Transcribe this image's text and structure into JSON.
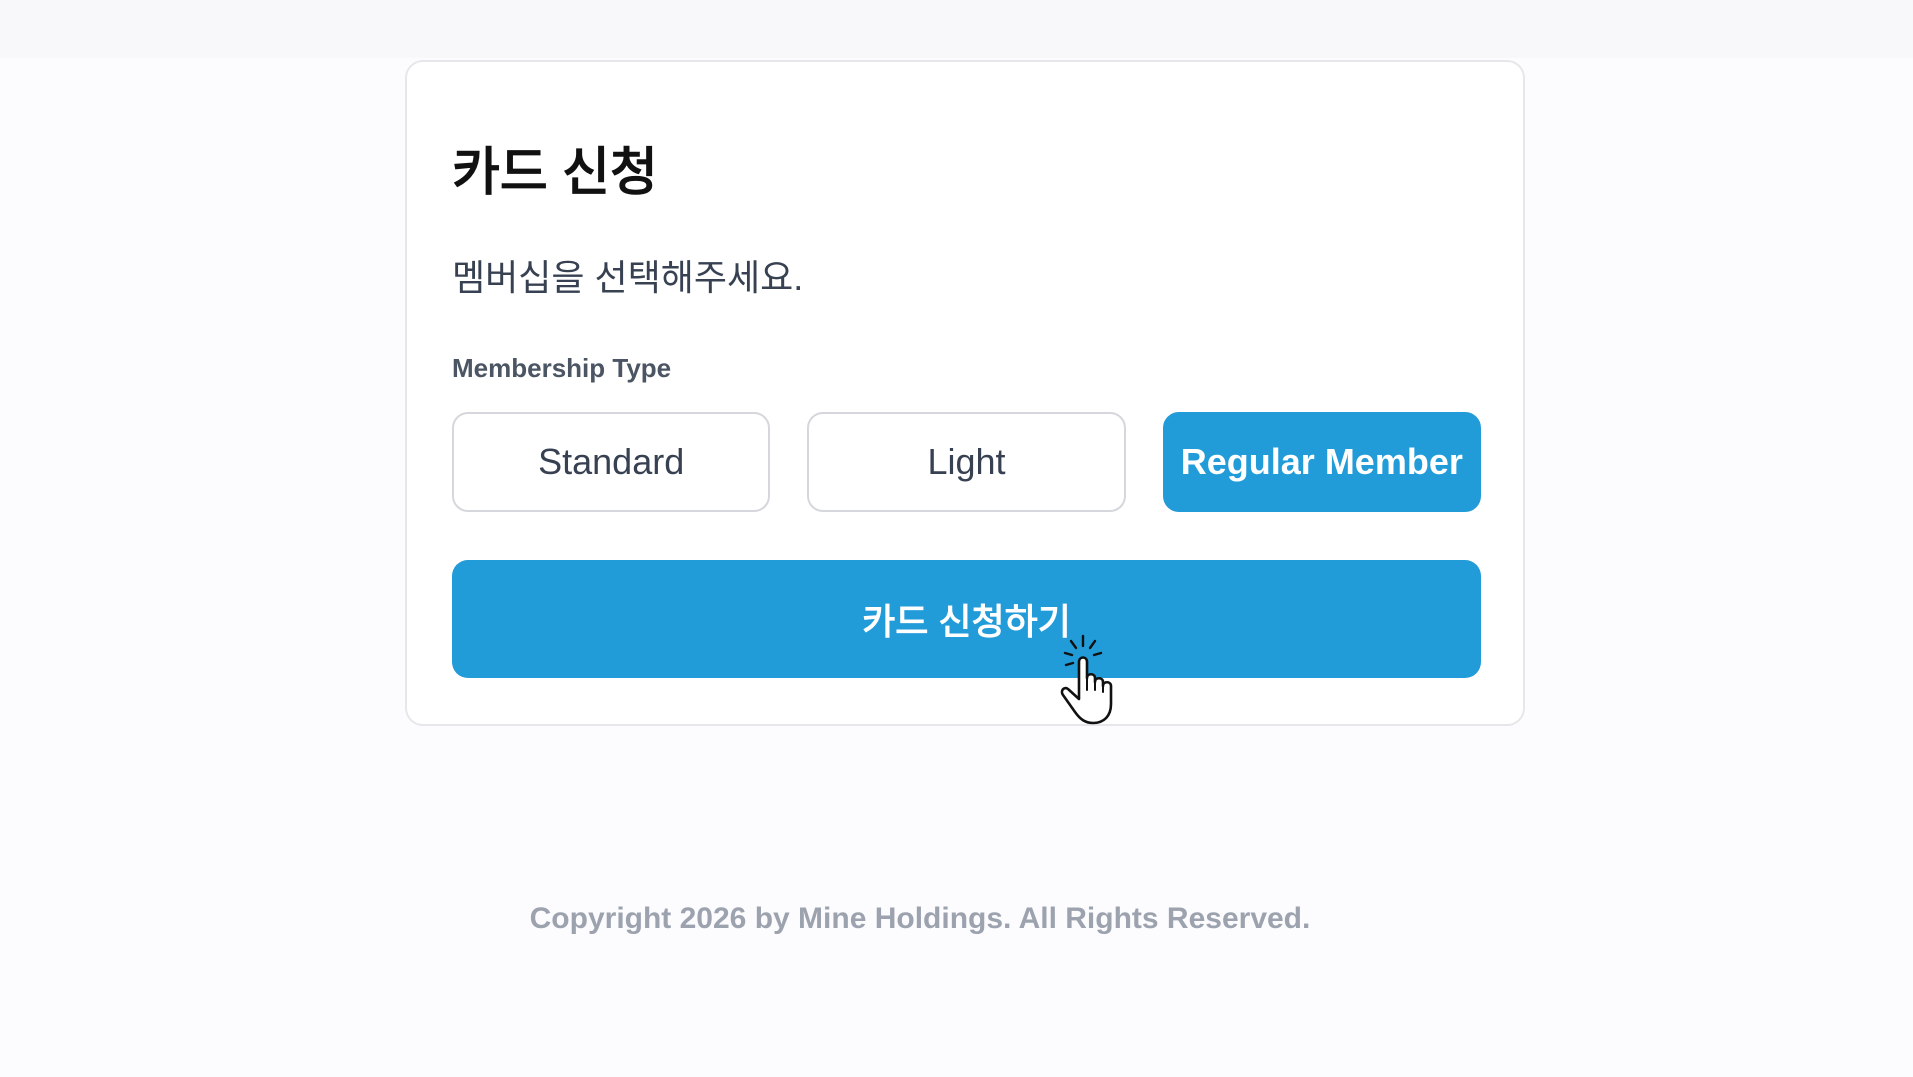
{
  "card": {
    "title": "카드 신청",
    "subtitle": "멤버십을 선택해주세요.",
    "membership_label": "Membership Type",
    "options": [
      {
        "label": "Standard",
        "selected": false
      },
      {
        "label": "Light",
        "selected": false
      },
      {
        "label": "Regular Member",
        "selected": true
      }
    ],
    "submit_label": "카드 신청하기"
  },
  "footer": {
    "copyright": "Copyright 2026 by Mine Holdings. All Rights Reserved."
  },
  "colors": {
    "accent": "#229bd9",
    "border": "#d5d7dc",
    "footer_text": "#9ca3af"
  },
  "icons": {
    "cursor": "hand-pointer-click-icon"
  }
}
